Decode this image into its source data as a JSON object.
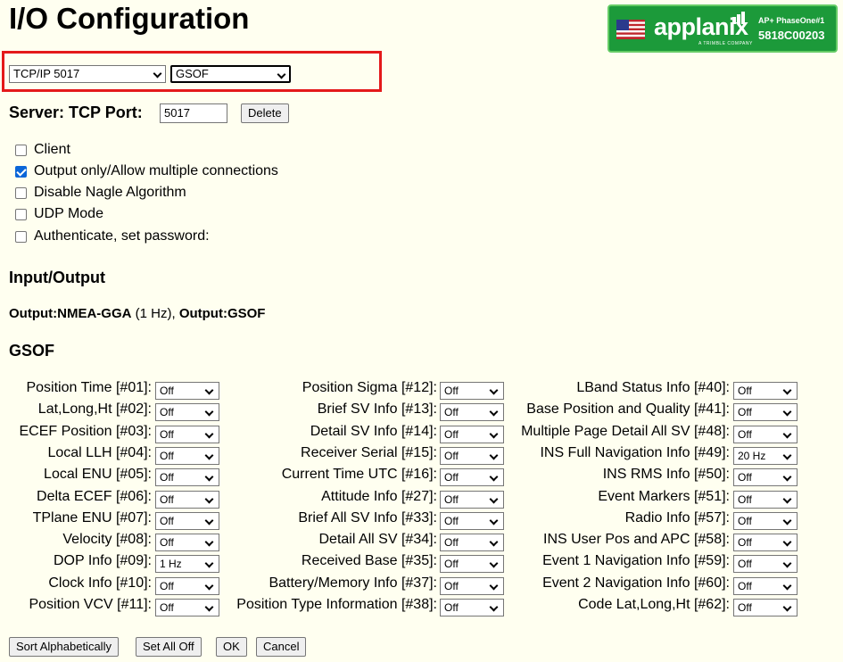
{
  "page": {
    "title": "I/O Configuration"
  },
  "logo": {
    "brand": "applanix",
    "tagline": "A TRIMBLE COMPANY",
    "model": "AP+ PhaseOne#1",
    "serial": "5818C00203",
    "flag_icon": "us-flag-icon"
  },
  "port_select": {
    "value": "TCP/IP 5017"
  },
  "protocol_select": {
    "value": "GSOF"
  },
  "server": {
    "label": "Server: TCP Port:",
    "port": "5017",
    "delete_label": "Delete"
  },
  "options": [
    {
      "label": "Client",
      "checked": false
    },
    {
      "label": "Output only/Allow multiple connections",
      "checked": true
    },
    {
      "label": "Disable Nagle Algorithm",
      "checked": false
    },
    {
      "label": "UDP Mode",
      "checked": false
    },
    {
      "label": "Authenticate, set password:",
      "checked": false
    }
  ],
  "io_section": {
    "heading": "Input/Output",
    "out1_label": "Output:",
    "out1_name": "NMEA-GGA",
    "out1_rate": " (1 Hz), ",
    "out2_label": "Output:",
    "out2_name": "GSOF"
  },
  "gsof_section": {
    "heading": "GSOF"
  },
  "gsof_columns": [
    [
      {
        "label": "Position Time [#01]:",
        "value": "Off"
      },
      {
        "label": "Lat,Long,Ht [#02]:",
        "value": "Off"
      },
      {
        "label": "ECEF Position [#03]:",
        "value": "Off"
      },
      {
        "label": "Local LLH [#04]:",
        "value": "Off"
      },
      {
        "label": "Local ENU [#05]:",
        "value": "Off"
      },
      {
        "label": "Delta ECEF [#06]:",
        "value": "Off"
      },
      {
        "label": "TPlane ENU [#07]:",
        "value": "Off"
      },
      {
        "label": "Velocity [#08]:",
        "value": "Off"
      },
      {
        "label": "DOP Info [#09]:",
        "value": "1 Hz"
      },
      {
        "label": "Clock Info [#10]:",
        "value": "Off"
      },
      {
        "label": "Position VCV [#11]:",
        "value": "Off"
      }
    ],
    [
      {
        "label": "Position Sigma [#12]:",
        "value": "Off"
      },
      {
        "label": "Brief SV Info [#13]:",
        "value": "Off"
      },
      {
        "label": "Detail SV Info [#14]:",
        "value": "Off"
      },
      {
        "label": "Receiver Serial [#15]:",
        "value": "Off"
      },
      {
        "label": "Current Time UTC [#16]:",
        "value": "Off"
      },
      {
        "label": "Attitude Info [#27]:",
        "value": "Off"
      },
      {
        "label": "Brief All SV Info [#33]:",
        "value": "Off"
      },
      {
        "label": "Detail All SV [#34]:",
        "value": "Off"
      },
      {
        "label": "Received Base [#35]:",
        "value": "Off"
      },
      {
        "label": "Battery/Memory Info [#37]:",
        "value": "Off"
      },
      {
        "label": "Position Type Information [#38]:",
        "value": "Off"
      }
    ],
    [
      {
        "label": "LBand Status Info [#40]:",
        "value": "Off"
      },
      {
        "label": "Base Position and Quality [#41]:",
        "value": "Off"
      },
      {
        "label": "Multiple Page Detail All SV [#48]:",
        "value": "Off"
      },
      {
        "label": "INS Full Navigation Info [#49]:",
        "value": "20 Hz"
      },
      {
        "label": "INS RMS Info [#50]:",
        "value": "Off"
      },
      {
        "label": "Event Markers [#51]:",
        "value": "Off"
      },
      {
        "label": "Radio Info [#57]:",
        "value": "Off"
      },
      {
        "label": "INS User Pos and APC [#58]:",
        "value": "Off"
      },
      {
        "label": "Event 1 Navigation Info [#59]:",
        "value": "Off"
      },
      {
        "label": "Event 2 Navigation Info [#60]:",
        "value": "Off"
      },
      {
        "label": "Code Lat,Long,Ht [#62]:",
        "value": "Off"
      }
    ]
  ],
  "actions": {
    "sort_label": "Sort Alphabetically",
    "set_all_off_label": "Set All Off",
    "ok_label": "OK",
    "cancel_label": "Cancel"
  },
  "colors": {
    "background": "#fffff0",
    "highlight": "#e41a1a",
    "logo_green": "#1c9a3a",
    "checkbox_checked": "#0b66d8"
  }
}
